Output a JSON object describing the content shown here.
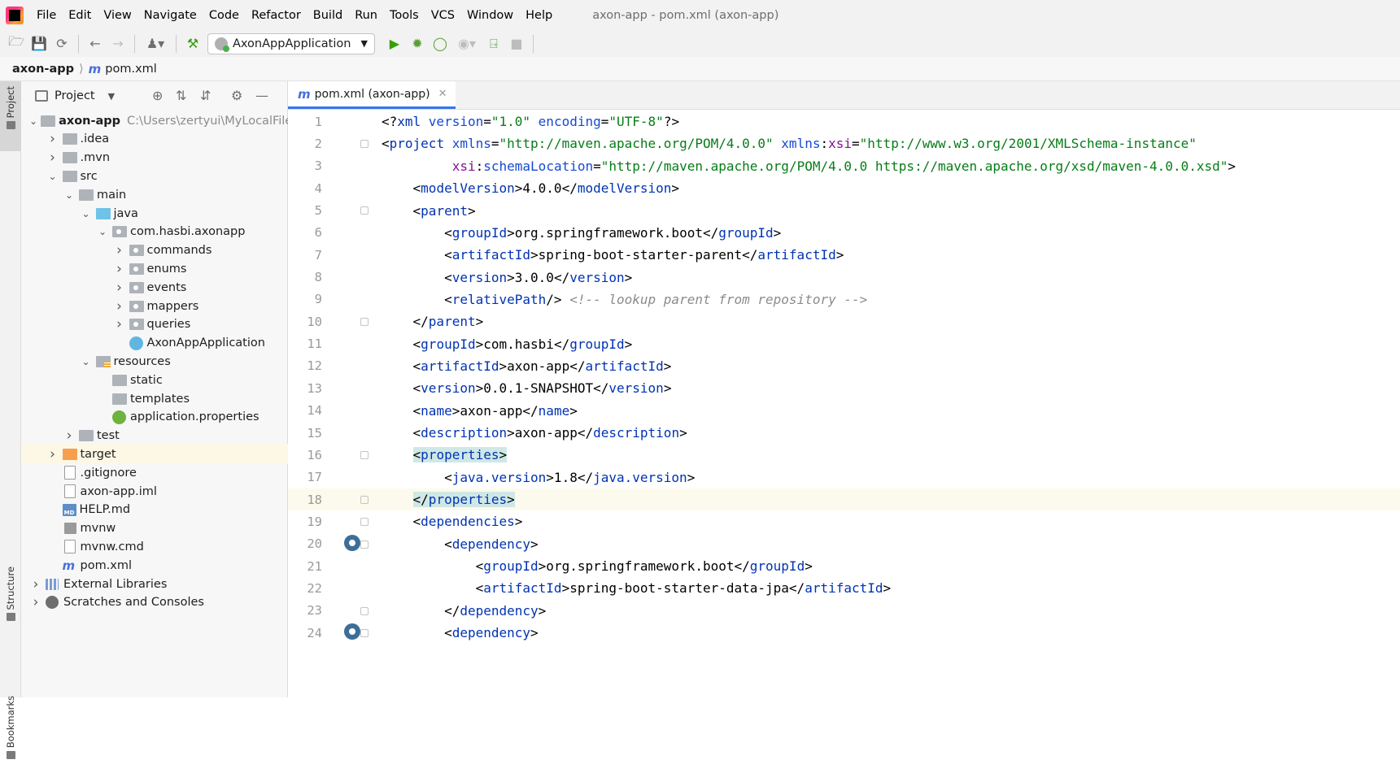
{
  "window": {
    "title": "axon-app - pom.xml (axon-app)"
  },
  "menu": [
    "File",
    "Edit",
    "View",
    "Navigate",
    "Code",
    "Refactor",
    "Build",
    "Run",
    "Tools",
    "VCS",
    "Window",
    "Help"
  ],
  "toolbar": {
    "run_config": "AxonAppApplication"
  },
  "breadcrumb": {
    "project": "axon-app",
    "file": "pom.xml"
  },
  "sidebar_tabs": {
    "project": "Project",
    "structure": "Structure",
    "bookmarks": "Bookmarks"
  },
  "project_panel": {
    "title": "Project",
    "tree": [
      {
        "label": "axon-app",
        "path": "C:\\Users\\zertyui\\MyLocalFiles\\",
        "icon": "module-folder",
        "depth": 0,
        "expanded": true,
        "bold": true
      },
      {
        "label": ".idea",
        "icon": "folder",
        "depth": 1,
        "expanded": false
      },
      {
        "label": ".mvn",
        "icon": "folder",
        "depth": 1,
        "expanded": false
      },
      {
        "label": "src",
        "icon": "folder",
        "depth": 1,
        "expanded": true
      },
      {
        "label": "main",
        "icon": "folder",
        "depth": 2,
        "expanded": true
      },
      {
        "label": "java",
        "icon": "source-folder",
        "depth": 3,
        "expanded": true
      },
      {
        "label": "com.hasbi.axonapp",
        "icon": "package",
        "depth": 4,
        "expanded": true
      },
      {
        "label": "commands",
        "icon": "package",
        "depth": 5,
        "expanded": false
      },
      {
        "label": "enums",
        "icon": "package",
        "depth": 5,
        "expanded": false
      },
      {
        "label": "events",
        "icon": "package",
        "depth": 5,
        "expanded": false
      },
      {
        "label": "mappers",
        "icon": "package",
        "depth": 5,
        "expanded": false
      },
      {
        "label": "queries",
        "icon": "package",
        "depth": 5,
        "expanded": false
      },
      {
        "label": "AxonAppApplication",
        "icon": "java-class",
        "depth": 5
      },
      {
        "label": "resources",
        "icon": "resources-folder",
        "depth": 3,
        "expanded": true
      },
      {
        "label": "static",
        "icon": "folder",
        "depth": 4
      },
      {
        "label": "templates",
        "icon": "folder",
        "depth": 4
      },
      {
        "label": "application.properties",
        "icon": "spring-properties",
        "depth": 4
      },
      {
        "label": "test",
        "icon": "folder",
        "depth": 2,
        "expanded": false
      },
      {
        "label": "target",
        "icon": "excluded-folder",
        "depth": 1,
        "expanded": false,
        "highlighted": true
      },
      {
        "label": ".gitignore",
        "icon": "file",
        "depth": 1
      },
      {
        "label": "axon-app.iml",
        "icon": "file",
        "depth": 1
      },
      {
        "label": "HELP.md",
        "icon": "markdown",
        "depth": 1
      },
      {
        "label": "mvnw",
        "icon": "terminal",
        "depth": 1
      },
      {
        "label": "mvnw.cmd",
        "icon": "file",
        "depth": 1
      },
      {
        "label": "pom.xml",
        "icon": "maven",
        "depth": 1
      },
      {
        "label": "External Libraries",
        "icon": "library",
        "depth": 0,
        "expanded": false
      },
      {
        "label": "Scratches and Consoles",
        "icon": "scratch",
        "depth": 0,
        "expanded": false
      }
    ]
  },
  "editor": {
    "tab": "pom.xml (axon-app)",
    "current_line": 18,
    "lines": [
      {
        "n": "1",
        "parts": [
          [
            "tx",
            "<?"
          ],
          [
            "tg",
            "xml "
          ],
          [
            "at",
            "version"
          ],
          [
            "tx",
            "="
          ],
          [
            "av",
            "\"1.0\" "
          ],
          [
            "at",
            "encoding"
          ],
          [
            "tx",
            "="
          ],
          [
            "av",
            "\"UTF-8\""
          ],
          [
            "tx",
            "?>"
          ]
        ]
      },
      {
        "n": "2",
        "fold": true,
        "parts": [
          [
            "tx",
            "<"
          ],
          [
            "tg",
            "project "
          ],
          [
            "at",
            "xmlns"
          ],
          [
            "tx",
            "="
          ],
          [
            "av",
            "\"http://maven.apache.org/POM/4.0.0\" "
          ],
          [
            "at",
            "xmlns"
          ],
          [
            "tx",
            ":"
          ],
          [
            "ns",
            "xsi"
          ],
          [
            "tx",
            "="
          ],
          [
            "av",
            "\"http://www.w3.org/2001/XMLSchema-instance\""
          ]
        ]
      },
      {
        "n": "3",
        "parts": [
          [
            "tx",
            "         "
          ],
          [
            "ns",
            "xsi"
          ],
          [
            "tx",
            ":"
          ],
          [
            "at",
            "schemaLocation"
          ],
          [
            "tx",
            "="
          ],
          [
            "av",
            "\"http://maven.apache.org/POM/4.0.0 https://maven.apache.org/xsd/maven-4.0.0.xsd\""
          ],
          [
            "tx",
            ">"
          ]
        ]
      },
      {
        "n": "4",
        "parts": [
          [
            "tx",
            "    <"
          ],
          [
            "tg",
            "modelVersion"
          ],
          [
            "tx",
            ">4.0.0</"
          ],
          [
            "tg",
            "modelVersion"
          ],
          [
            "tx",
            ">"
          ]
        ]
      },
      {
        "n": "5",
        "fold": true,
        "parts": [
          [
            "tx",
            "    <"
          ],
          [
            "tg",
            "parent"
          ],
          [
            "tx",
            ">"
          ]
        ]
      },
      {
        "n": "6",
        "parts": [
          [
            "tx",
            "        <"
          ],
          [
            "tg",
            "groupId"
          ],
          [
            "tx",
            ">org.springframework.boot</"
          ],
          [
            "tg",
            "groupId"
          ],
          [
            "tx",
            ">"
          ]
        ]
      },
      {
        "n": "7",
        "parts": [
          [
            "tx",
            "        <"
          ],
          [
            "tg",
            "artifactId"
          ],
          [
            "tx",
            ">spring-boot-starter-parent</"
          ],
          [
            "tg",
            "artifactId"
          ],
          [
            "tx",
            ">"
          ]
        ]
      },
      {
        "n": "8",
        "parts": [
          [
            "tx",
            "        <"
          ],
          [
            "tg",
            "version"
          ],
          [
            "tx",
            ">3.0.0</"
          ],
          [
            "tg",
            "version"
          ],
          [
            "tx",
            ">"
          ]
        ]
      },
      {
        "n": "9",
        "parts": [
          [
            "tx",
            "        <"
          ],
          [
            "tg",
            "relativePath"
          ],
          [
            "tx",
            "/> "
          ],
          [
            "cm",
            "<!-- lookup parent from repository -->"
          ]
        ]
      },
      {
        "n": "10",
        "fold": true,
        "parts": [
          [
            "tx",
            "    </"
          ],
          [
            "tg",
            "parent"
          ],
          [
            "tx",
            ">"
          ]
        ]
      },
      {
        "n": "11",
        "parts": [
          [
            "tx",
            "    <"
          ],
          [
            "tg",
            "groupId"
          ],
          [
            "tx",
            ">com.hasbi</"
          ],
          [
            "tg",
            "groupId"
          ],
          [
            "tx",
            ">"
          ]
        ]
      },
      {
        "n": "12",
        "parts": [
          [
            "tx",
            "    <"
          ],
          [
            "tg",
            "artifactId"
          ],
          [
            "tx",
            ">axon-app</"
          ],
          [
            "tg",
            "artifactId"
          ],
          [
            "tx",
            ">"
          ]
        ]
      },
      {
        "n": "13",
        "parts": [
          [
            "tx",
            "    <"
          ],
          [
            "tg",
            "version"
          ],
          [
            "tx",
            ">0.0.1-SNAPSHOT</"
          ],
          [
            "tg",
            "version"
          ],
          [
            "tx",
            ">"
          ]
        ]
      },
      {
        "n": "14",
        "parts": [
          [
            "tx",
            "    <"
          ],
          [
            "tg",
            "name"
          ],
          [
            "tx",
            ">axon-app</"
          ],
          [
            "tg",
            "name"
          ],
          [
            "tx",
            ">"
          ]
        ]
      },
      {
        "n": "15",
        "parts": [
          [
            "tx",
            "    <"
          ],
          [
            "tg",
            "description"
          ],
          [
            "tx",
            ">axon-app</"
          ],
          [
            "tg",
            "description"
          ],
          [
            "tx",
            ">"
          ]
        ]
      },
      {
        "n": "16",
        "fold": true,
        "parts": [
          [
            "tx",
            "    "
          ],
          [
            "hb",
            "<properties>"
          ]
        ]
      },
      {
        "n": "17",
        "parts": [
          [
            "tx",
            "        <"
          ],
          [
            "tg",
            "java.version"
          ],
          [
            "tx",
            ">1.8</"
          ],
          [
            "tg",
            "java.version"
          ],
          [
            "tx",
            ">"
          ]
        ]
      },
      {
        "n": "18",
        "fold": true,
        "parts": [
          [
            "tx",
            "    "
          ],
          [
            "hb",
            "</properties>"
          ]
        ]
      },
      {
        "n": "19",
        "fold": true,
        "parts": [
          [
            "tx",
            "    <"
          ],
          [
            "tg",
            "dependencies"
          ],
          [
            "tx",
            ">"
          ]
        ]
      },
      {
        "n": "20",
        "fold": true,
        "marker": true,
        "parts": [
          [
            "tx",
            "        <"
          ],
          [
            "tg",
            "dependency"
          ],
          [
            "tx",
            ">"
          ]
        ]
      },
      {
        "n": "21",
        "parts": [
          [
            "tx",
            "            <"
          ],
          [
            "tg",
            "groupId"
          ],
          [
            "tx",
            ">org.springframework.boot</"
          ],
          [
            "tg",
            "groupId"
          ],
          [
            "tx",
            ">"
          ]
        ]
      },
      {
        "n": "22",
        "parts": [
          [
            "tx",
            "            <"
          ],
          [
            "tg",
            "artifactId"
          ],
          [
            "tx",
            ">spring-boot-starter-data-jpa</"
          ],
          [
            "tg",
            "artifactId"
          ],
          [
            "tx",
            ">"
          ]
        ]
      },
      {
        "n": "23",
        "fold": true,
        "parts": [
          [
            "tx",
            "        </"
          ],
          [
            "tg",
            "dependency"
          ],
          [
            "tx",
            ">"
          ]
        ]
      },
      {
        "n": "24",
        "fold": true,
        "marker": true,
        "parts": [
          [
            "tx",
            "        <"
          ],
          [
            "tg",
            "dependency"
          ],
          [
            "tx",
            ">"
          ]
        ]
      }
    ]
  }
}
